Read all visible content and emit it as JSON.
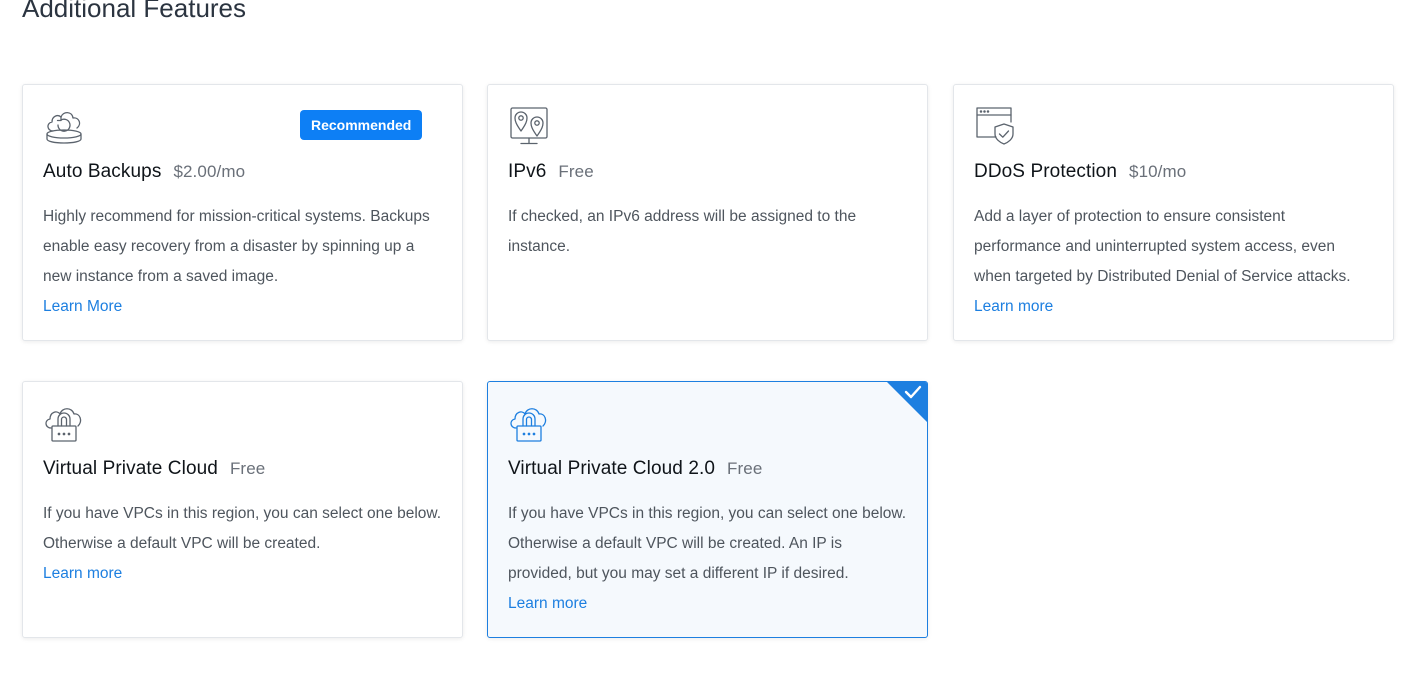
{
  "page": {
    "title": "Additional Features"
  },
  "cards": [
    {
      "title": "Auto Backups",
      "price": "$2.00/mo",
      "badge": "Recommended",
      "description": "Highly recommend for mission-critical systems. Backups enable easy recovery from a disaster by spinning up a new instance from a saved image.",
      "link": "Learn More",
      "icon": "cloud-backup-icon",
      "selected": false
    },
    {
      "title": "IPv6",
      "price": "Free",
      "description": "If checked, an IPv6 address will be assigned to the instance.",
      "link": "",
      "icon": "network-location-icon",
      "selected": false
    },
    {
      "title": "DDoS Protection",
      "price": "$10/mo",
      "description": "Add a layer of protection to ensure consistent performance and uninterrupted system access, even when targeted by Distributed Denial of Service attacks.",
      "link": "Learn more",
      "icon": "shield-window-icon",
      "selected": false
    },
    {
      "title": "Virtual Private Cloud",
      "price": "Free",
      "description": "If you have VPCs in this region, you can select one below. Otherwise a default VPC will be created.",
      "link": "Learn more",
      "icon": "cloud-lock-icon",
      "selected": false
    },
    {
      "title": "Virtual Private Cloud 2.0",
      "price": "Free",
      "description": "If you have VPCs in this region, you can select one below. Otherwise a default VPC will be created. An IP is provided, but you may set a different IP if desired.",
      "link": "Learn more",
      "icon": "cloud-lock-icon",
      "selected": true
    }
  ],
  "colors": {
    "accent": "#1d7fe0",
    "badge": "#0d7ff5",
    "selected_background": "#f5f9fd",
    "icon_default": "#5b636d",
    "icon_selected": "#1d7fe0"
  }
}
